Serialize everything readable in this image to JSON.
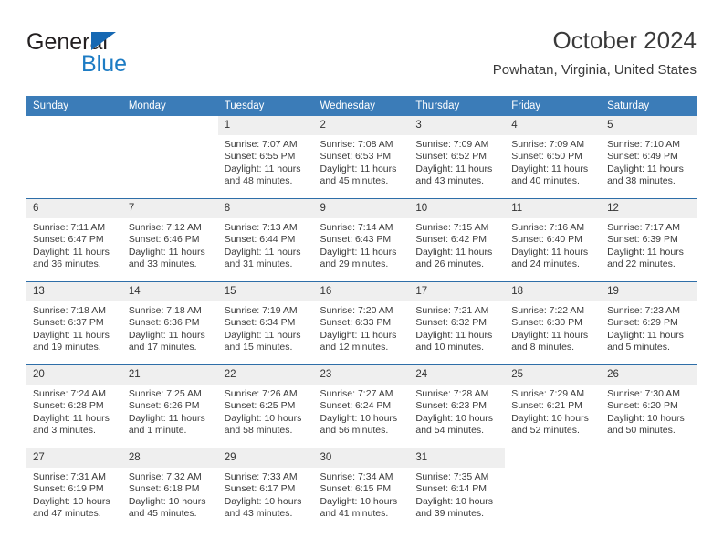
{
  "brand": {
    "name_top": "General",
    "name_bottom": "Blue",
    "triangle_color": "#1668b3",
    "blue_color": "#1d7cc4"
  },
  "header": {
    "title": "October 2024",
    "subtitle": "Powhatan, Virginia, United States",
    "header_bg": "#3b7cb8",
    "row_border": "#2e6ea8",
    "daynum_bg": "#efefef"
  },
  "weekdays": [
    "Sunday",
    "Monday",
    "Tuesday",
    "Wednesday",
    "Thursday",
    "Friday",
    "Saturday"
  ],
  "labels": {
    "sunrise_prefix": "Sunrise:",
    "sunset_prefix": "Sunset:",
    "daylight_prefix": "Daylight:"
  },
  "weeks": [
    [
      {
        "blank": true
      },
      {
        "blank": true
      },
      {
        "day": "1",
        "sunrise": "Sunrise: 7:07 AM",
        "sunset": "Sunset: 6:55 PM",
        "daylight": "Daylight: 11 hours and 48 minutes."
      },
      {
        "day": "2",
        "sunrise": "Sunrise: 7:08 AM",
        "sunset": "Sunset: 6:53 PM",
        "daylight": "Daylight: 11 hours and 45 minutes."
      },
      {
        "day": "3",
        "sunrise": "Sunrise: 7:09 AM",
        "sunset": "Sunset: 6:52 PM",
        "daylight": "Daylight: 11 hours and 43 minutes."
      },
      {
        "day": "4",
        "sunrise": "Sunrise: 7:09 AM",
        "sunset": "Sunset: 6:50 PM",
        "daylight": "Daylight: 11 hours and 40 minutes."
      },
      {
        "day": "5",
        "sunrise": "Sunrise: 7:10 AM",
        "sunset": "Sunset: 6:49 PM",
        "daylight": "Daylight: 11 hours and 38 minutes."
      }
    ],
    [
      {
        "day": "6",
        "sunrise": "Sunrise: 7:11 AM",
        "sunset": "Sunset: 6:47 PM",
        "daylight": "Daylight: 11 hours and 36 minutes."
      },
      {
        "day": "7",
        "sunrise": "Sunrise: 7:12 AM",
        "sunset": "Sunset: 6:46 PM",
        "daylight": "Daylight: 11 hours and 33 minutes."
      },
      {
        "day": "8",
        "sunrise": "Sunrise: 7:13 AM",
        "sunset": "Sunset: 6:44 PM",
        "daylight": "Daylight: 11 hours and 31 minutes."
      },
      {
        "day": "9",
        "sunrise": "Sunrise: 7:14 AM",
        "sunset": "Sunset: 6:43 PM",
        "daylight": "Daylight: 11 hours and 29 minutes."
      },
      {
        "day": "10",
        "sunrise": "Sunrise: 7:15 AM",
        "sunset": "Sunset: 6:42 PM",
        "daylight": "Daylight: 11 hours and 26 minutes."
      },
      {
        "day": "11",
        "sunrise": "Sunrise: 7:16 AM",
        "sunset": "Sunset: 6:40 PM",
        "daylight": "Daylight: 11 hours and 24 minutes."
      },
      {
        "day": "12",
        "sunrise": "Sunrise: 7:17 AM",
        "sunset": "Sunset: 6:39 PM",
        "daylight": "Daylight: 11 hours and 22 minutes."
      }
    ],
    [
      {
        "day": "13",
        "sunrise": "Sunrise: 7:18 AM",
        "sunset": "Sunset: 6:37 PM",
        "daylight": "Daylight: 11 hours and 19 minutes."
      },
      {
        "day": "14",
        "sunrise": "Sunrise: 7:18 AM",
        "sunset": "Sunset: 6:36 PM",
        "daylight": "Daylight: 11 hours and 17 minutes."
      },
      {
        "day": "15",
        "sunrise": "Sunrise: 7:19 AM",
        "sunset": "Sunset: 6:34 PM",
        "daylight": "Daylight: 11 hours and 15 minutes."
      },
      {
        "day": "16",
        "sunrise": "Sunrise: 7:20 AM",
        "sunset": "Sunset: 6:33 PM",
        "daylight": "Daylight: 11 hours and 12 minutes."
      },
      {
        "day": "17",
        "sunrise": "Sunrise: 7:21 AM",
        "sunset": "Sunset: 6:32 PM",
        "daylight": "Daylight: 11 hours and 10 minutes."
      },
      {
        "day": "18",
        "sunrise": "Sunrise: 7:22 AM",
        "sunset": "Sunset: 6:30 PM",
        "daylight": "Daylight: 11 hours and 8 minutes."
      },
      {
        "day": "19",
        "sunrise": "Sunrise: 7:23 AM",
        "sunset": "Sunset: 6:29 PM",
        "daylight": "Daylight: 11 hours and 5 minutes."
      }
    ],
    [
      {
        "day": "20",
        "sunrise": "Sunrise: 7:24 AM",
        "sunset": "Sunset: 6:28 PM",
        "daylight": "Daylight: 11 hours and 3 minutes."
      },
      {
        "day": "21",
        "sunrise": "Sunrise: 7:25 AM",
        "sunset": "Sunset: 6:26 PM",
        "daylight": "Daylight: 11 hours and 1 minute."
      },
      {
        "day": "22",
        "sunrise": "Sunrise: 7:26 AM",
        "sunset": "Sunset: 6:25 PM",
        "daylight": "Daylight: 10 hours and 58 minutes."
      },
      {
        "day": "23",
        "sunrise": "Sunrise: 7:27 AM",
        "sunset": "Sunset: 6:24 PM",
        "daylight": "Daylight: 10 hours and 56 minutes."
      },
      {
        "day": "24",
        "sunrise": "Sunrise: 7:28 AM",
        "sunset": "Sunset: 6:23 PM",
        "daylight": "Daylight: 10 hours and 54 minutes."
      },
      {
        "day": "25",
        "sunrise": "Sunrise: 7:29 AM",
        "sunset": "Sunset: 6:21 PM",
        "daylight": "Daylight: 10 hours and 52 minutes."
      },
      {
        "day": "26",
        "sunrise": "Sunrise: 7:30 AM",
        "sunset": "Sunset: 6:20 PM",
        "daylight": "Daylight: 10 hours and 50 minutes."
      }
    ],
    [
      {
        "day": "27",
        "sunrise": "Sunrise: 7:31 AM",
        "sunset": "Sunset: 6:19 PM",
        "daylight": "Daylight: 10 hours and 47 minutes."
      },
      {
        "day": "28",
        "sunrise": "Sunrise: 7:32 AM",
        "sunset": "Sunset: 6:18 PM",
        "daylight": "Daylight: 10 hours and 45 minutes."
      },
      {
        "day": "29",
        "sunrise": "Sunrise: 7:33 AM",
        "sunset": "Sunset: 6:17 PM",
        "daylight": "Daylight: 10 hours and 43 minutes."
      },
      {
        "day": "30",
        "sunrise": "Sunrise: 7:34 AM",
        "sunset": "Sunset: 6:15 PM",
        "daylight": "Daylight: 10 hours and 41 minutes."
      },
      {
        "day": "31",
        "sunrise": "Sunrise: 7:35 AM",
        "sunset": "Sunset: 6:14 PM",
        "daylight": "Daylight: 10 hours and 39 minutes."
      },
      {
        "blank": true
      },
      {
        "blank": true
      }
    ]
  ]
}
